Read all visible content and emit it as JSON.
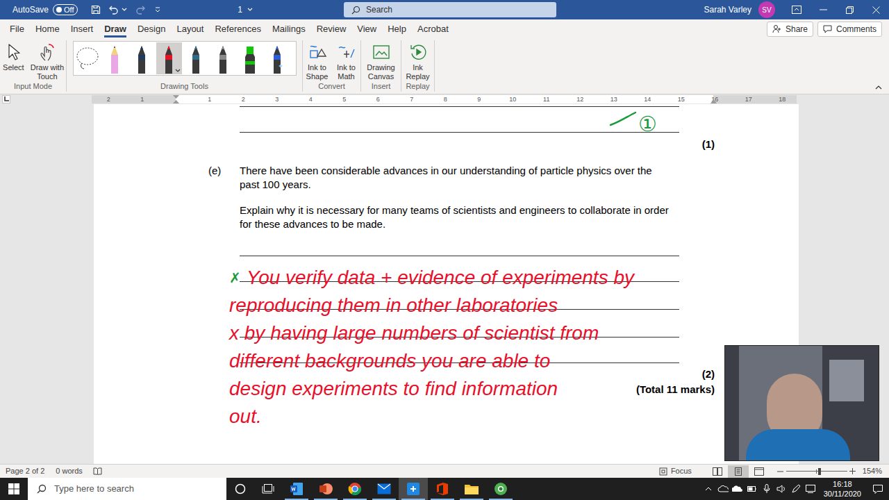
{
  "titlebar": {
    "autosave": {
      "label": "AutoSave",
      "state": "Off",
      "on": false
    },
    "doc_title": "1",
    "search": "Search",
    "user": "Sarah Varley",
    "avatar": "SV"
  },
  "tabs": [
    {
      "label": "File",
      "selected": false
    },
    {
      "label": "Home",
      "selected": false
    },
    {
      "label": "Insert",
      "selected": false
    },
    {
      "label": "Draw",
      "selected": true
    },
    {
      "label": "Design",
      "selected": false
    },
    {
      "label": "Layout",
      "selected": false
    },
    {
      "label": "References",
      "selected": false
    },
    {
      "label": "Mailings",
      "selected": false
    },
    {
      "label": "Review",
      "selected": false
    },
    {
      "label": "View",
      "selected": false
    },
    {
      "label": "Help",
      "selected": false
    },
    {
      "label": "Acrobat",
      "selected": false
    }
  ],
  "share": "Share",
  "comments": "Comments",
  "input_mode": {
    "label": "Input Mode",
    "buttons": [
      "Select",
      "Draw with Touch"
    ]
  },
  "drawing_tools": {
    "label": "Drawing Tools",
    "pens": [
      {
        "kind": "lasso",
        "color": "#333333",
        "selected": false
      },
      {
        "kind": "pencil",
        "color": "#e9a8e4",
        "selected": false
      },
      {
        "kind": "pen",
        "color": "#1f3a5f",
        "selected": false
      },
      {
        "kind": "pen",
        "color": "#e81123",
        "selected": true
      },
      {
        "kind": "pen",
        "color": "#2e6b8a",
        "selected": false
      },
      {
        "kind": "pen",
        "color": "#8a8a8a",
        "selected": false
      },
      {
        "kind": "highlighter",
        "color": "#16c60c",
        "selected": false
      },
      {
        "kind": "galaxy",
        "color": "#2b5fd9",
        "selected": false
      }
    ]
  },
  "convert": {
    "label": "Convert",
    "buttons": [
      "Ink to Shape",
      "Ink to Math"
    ]
  },
  "insert": {
    "label": "Insert",
    "buttons": [
      "Drawing Canvas"
    ]
  },
  "replay": {
    "label": "Replay",
    "buttons": [
      "Ink Replay"
    ]
  },
  "ruler": {
    "left": [
      "2",
      "1"
    ],
    "right": [
      "1",
      "2",
      "3",
      "4",
      "5",
      "6",
      "7",
      "8",
      "9",
      "10",
      "11",
      "12",
      "13",
      "14",
      "15",
      "16",
      "17",
      "18"
    ]
  },
  "document": {
    "prev_marks": "(1)",
    "prev_score": {
      "text": "①",
      "color": "#1a9a3a"
    },
    "question": {
      "label": "(e)",
      "paragraphs": [
        "There have been considerable advances in our understanding of particle physics over the past 100 years.",
        "Explain why it is necessary for many teams of scientists and engineers to collaborate in order for these advances to be made."
      ]
    },
    "answer_marks": "(2)",
    "total": "(Total 11 marks)",
    "first_line_mark": {
      "text": "✗",
      "color": "#1a9a3a"
    },
    "ink": {
      "color": "#e8102a",
      "lines": [
        "You verify data + evidence of experiments by",
        "reproducing them in other laboratories",
        "x by having large numbers of scientist from",
        "different backgrounds you are able to",
        "design experiments to find information",
        "out."
      ]
    }
  },
  "status_bar": {
    "page": "Page 2 of 2",
    "words": "0 words",
    "focus": "Focus",
    "views": [
      {
        "selected": false
      },
      {
        "selected": true
      },
      {
        "selected": false
      }
    ],
    "zoom_level": 0.55,
    "zoom": "154%"
  },
  "taskbar": {
    "search": "Type here to search",
    "apps": [
      {
        "running": true,
        "active": false
      },
      {
        "running": true,
        "active": false
      },
      {
        "running": true,
        "active": false
      },
      {
        "running": true,
        "active": false
      },
      {
        "running": true,
        "active": true
      },
      {
        "running": true,
        "active": false
      },
      {
        "running": true,
        "active": false
      },
      {
        "running": true,
        "active": false
      }
    ],
    "time": "16:18",
    "date": "30/11/2020"
  }
}
